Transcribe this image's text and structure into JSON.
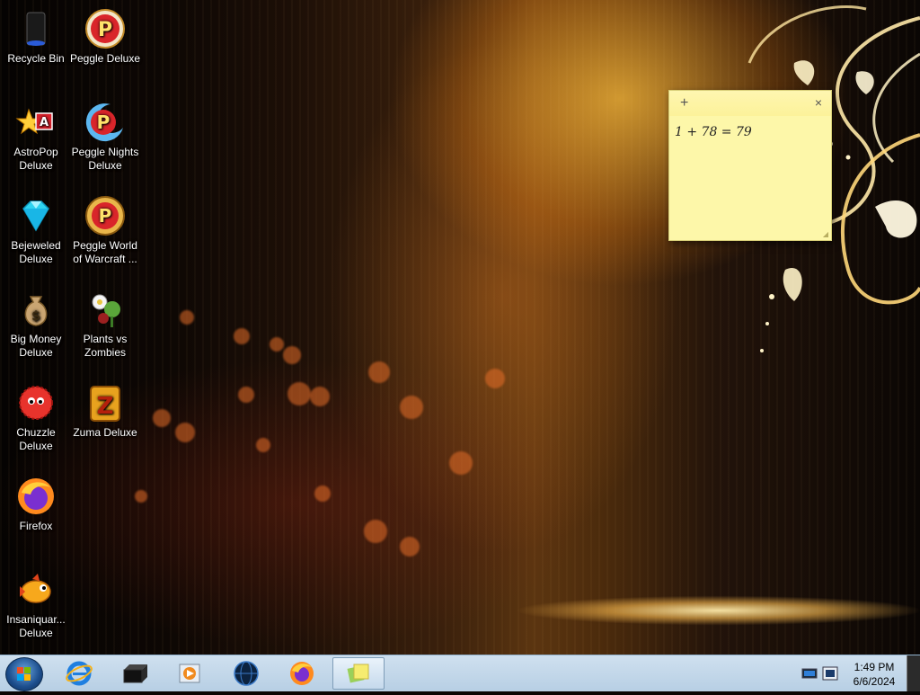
{
  "desktop": {
    "icons": [
      {
        "label": "Recycle Bin",
        "icon": "recycle-bin-icon"
      },
      {
        "label": "Peggle Deluxe",
        "icon": "peggle-deluxe-icon"
      },
      {
        "label": "AstroPop Deluxe",
        "icon": "astropop-icon"
      },
      {
        "label": "Peggle Nights Deluxe",
        "icon": "peggle-nights-icon"
      },
      {
        "label": "Bejeweled Deluxe",
        "icon": "bejeweled-icon"
      },
      {
        "label": "Peggle World of Warcraft ...",
        "icon": "peggle-wow-icon"
      },
      {
        "label": "Big Money Deluxe",
        "icon": "money-bag-icon"
      },
      {
        "label": "Plants vs Zombies",
        "icon": "plants-vs-zombies-icon"
      },
      {
        "label": "Chuzzle Deluxe",
        "icon": "chuzzle-icon"
      },
      {
        "label": "Zuma Deluxe",
        "icon": "zuma-icon"
      },
      {
        "label": "Firefox",
        "icon": "firefox-icon"
      },
      {
        "label": "Insaniquar... Deluxe",
        "icon": "insaniquarium-icon"
      }
    ]
  },
  "sticky_note": {
    "add_symbol": "+",
    "close_symbol": "×",
    "text": "1 + 78 = 79"
  },
  "taskbar": {
    "pinned": [
      {
        "icon": "internet-explorer-icon"
      },
      {
        "icon": "terminal-icon"
      },
      {
        "icon": "media-player-icon"
      },
      {
        "icon": "globe-icon"
      },
      {
        "icon": "firefox-icon"
      },
      {
        "icon": "sticky-notes-icon",
        "active": true
      }
    ],
    "tray": {
      "icons": [
        "network-icon",
        "action-center-icon"
      ]
    },
    "clock": {
      "time": "1:49 PM",
      "date": "6/6/2024"
    }
  },
  "colors": {
    "note_bg": "#fdf7a9",
    "taskbar_bg": "#c3d7ea",
    "wallpaper_glow": "#ffbe3c"
  }
}
